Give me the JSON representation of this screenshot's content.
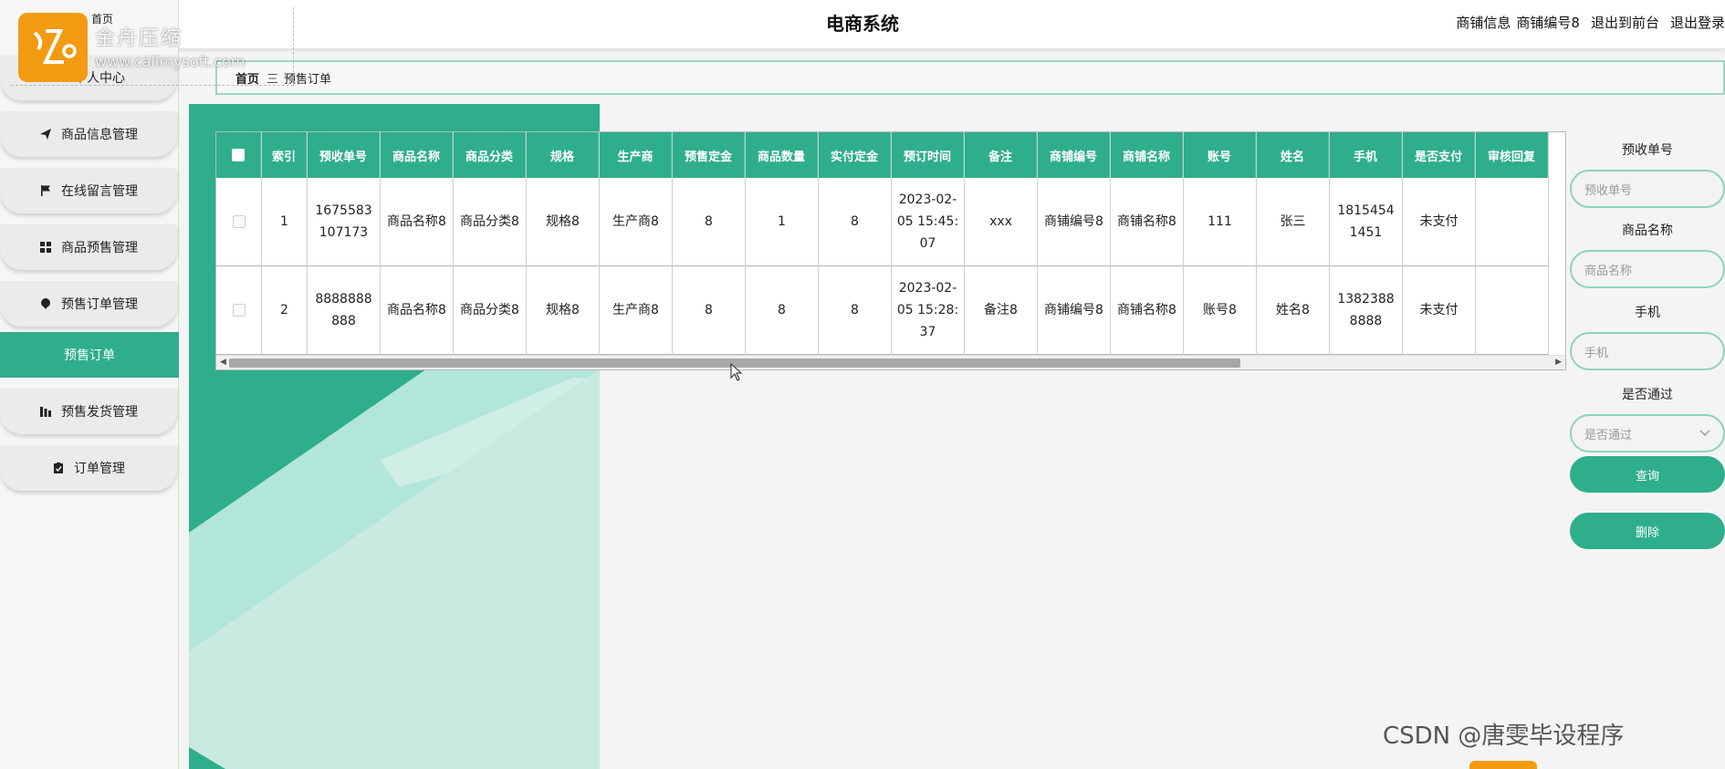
{
  "header": {
    "title": "电商系统",
    "shop_info": "商铺信息",
    "shop_id": "商铺编号8",
    "exit_front": "退出到前台",
    "logout": "退出登录"
  },
  "logo": {
    "text": "金舟压缩",
    "url": "www.callmysoft.com"
  },
  "sidebar": {
    "home": "首页",
    "items": [
      {
        "label": "个人中心",
        "icon": "person-icon"
      },
      {
        "label": "商品信息管理",
        "icon": "send-icon"
      },
      {
        "label": "在线留言管理",
        "icon": "flag-icon"
      },
      {
        "label": "商品预售管理",
        "icon": "grid-icon"
      },
      {
        "label": "预售订单管理",
        "icon": "pin-icon"
      },
      {
        "label": "预售订单",
        "icon": ""
      },
      {
        "label": "预售发货管理",
        "icon": "chart-icon"
      },
      {
        "label": "订单管理",
        "icon": "clipboard-icon"
      }
    ]
  },
  "breadcrumb": {
    "home": "首页",
    "separator": "三",
    "current": "预售订单"
  },
  "table": {
    "headers": [
      "",
      "索引",
      "预收单号",
      "商品名称",
      "商品分类",
      "规格",
      "生产商",
      "预售定金",
      "商品数量",
      "实付定金",
      "预订时间",
      "备注",
      "商铺编号",
      "商铺名称",
      "账号",
      "姓名",
      "手机",
      "是否支付",
      "审核回复"
    ],
    "rows": [
      [
        "",
        "1",
        "1675583107173",
        "商品名称8",
        "商品分类8",
        "规格8",
        "生产商8",
        "8",
        "1",
        "8",
        "2023-02-05 15:45:07",
        "xxx",
        "商铺编号8",
        "商铺名称8",
        "111",
        "张三",
        "18154541451",
        "未支付",
        ""
      ],
      [
        "",
        "2",
        "8888888888",
        "商品名称8",
        "商品分类8",
        "规格8",
        "生产商8",
        "8",
        "8",
        "8",
        "2023-02-05 15:28:37",
        "备注8",
        "商铺编号8",
        "商铺名称8",
        "账号8",
        "姓名8",
        "13823888888",
        "未支付",
        ""
      ]
    ]
  },
  "search": {
    "order_no_label": "预收单号",
    "order_no_placeholder": "预收单号",
    "product_name_label": "商品名称",
    "product_name_placeholder": "商品名称",
    "phone_label": "手机",
    "phone_placeholder": "手机",
    "approved_label": "是否通过",
    "approved_placeholder": "是否通过",
    "query_button": "查询",
    "delete_button": "删除"
  },
  "watermark": "CSDN @唐雯毕设程序",
  "colors": {
    "accent": "#2fae8c",
    "accent_light": "#8fd3bf",
    "logo": "#f29b11"
  }
}
